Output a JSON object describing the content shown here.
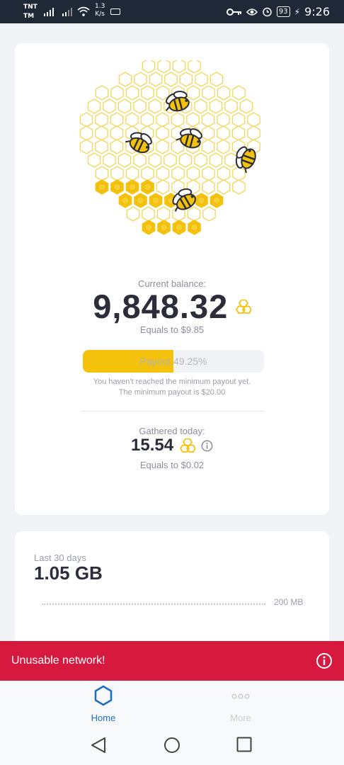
{
  "status_bar": {
    "carrier_top": "TNT",
    "carrier_bottom": "TM",
    "speed_value": "1.3",
    "speed_unit": "K/s",
    "battery": "93",
    "time": "9:26"
  },
  "balance": {
    "label": "Current balance:",
    "value": "9,848.32",
    "equals": "Equals to $9.85"
  },
  "payout": {
    "label": "Payout 49.25%",
    "progress_fraction": 0.5,
    "note_line1": "You haven't reached the minimum payout yet.",
    "note_line2": "The minimum payout is $20.00"
  },
  "gathered": {
    "label": "Gathered today:",
    "value": "15.54",
    "equals": "Equals to $0.02"
  },
  "traffic": {
    "period_label": "Last 30 days",
    "value": "1.05 GB",
    "scale_label": "200 MB"
  },
  "banner": {
    "message": "Unusable network!"
  },
  "tabs": [
    {
      "label": "Home",
      "icon": "hexagon-icon",
      "active": true
    },
    {
      "label": "More",
      "icon": "more-dots-icon",
      "active": false
    }
  ],
  "colors": {
    "accent_yellow": "#f4c20d",
    "alert_red": "#d8193f",
    "active_tab_blue": "#1c70c4",
    "text_dark": "#2b2d3a"
  }
}
